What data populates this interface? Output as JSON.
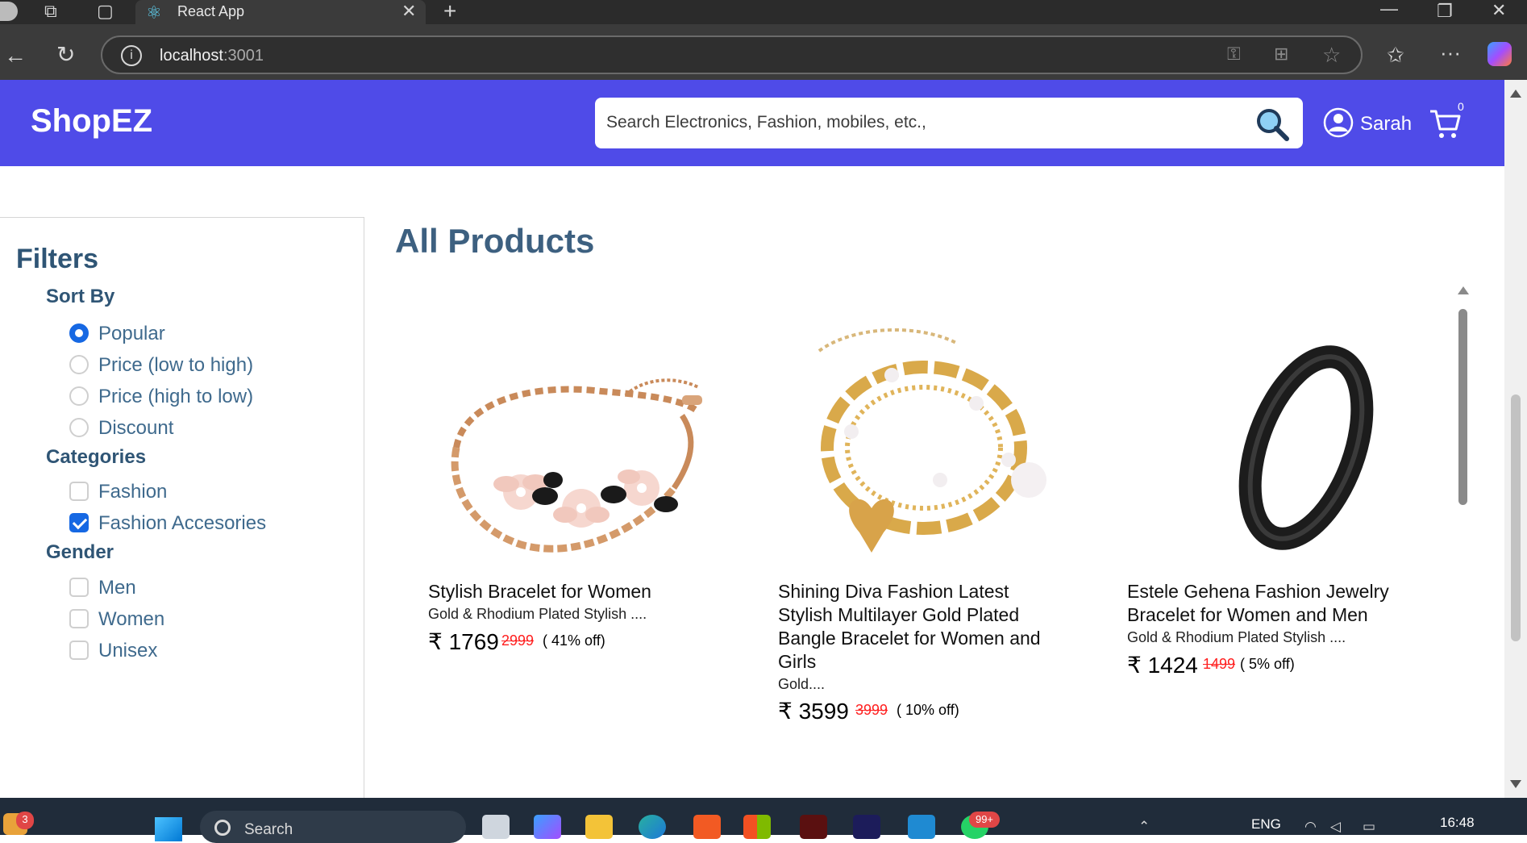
{
  "browser": {
    "tab_title": "React App",
    "url_host": "localhost",
    "url_port": ":3001"
  },
  "header": {
    "logo": "ShopEZ",
    "search_placeholder": "Search Electronics, Fashion, mobiles, etc.,",
    "user_name": "Sarah",
    "cart_count": "0"
  },
  "filters": {
    "title": "Filters",
    "sort_heading": "Sort By",
    "sort_options": [
      "Popular",
      "Price (low to high)",
      "Price (high to low)",
      "Discount"
    ],
    "sort_selected": "Popular",
    "categories_heading": "Categories",
    "categories": [
      "Fashion",
      "Fashion Accesories"
    ],
    "categories_checked": [
      "Fashion Accesories"
    ],
    "gender_heading": "Gender",
    "genders": [
      "Men",
      "Women",
      "Unisex"
    ]
  },
  "products": {
    "heading": "All Products",
    "items": [
      {
        "title": "Stylish Bracelet for Women",
        "desc": "Gold & Rhodium Plated Stylish ....",
        "price": "₹ 1769",
        "old_price": "2999",
        "discount": "( 41% off)",
        "image": "rose-gold-flower-bracelet"
      },
      {
        "title": "Shining Diva Fashion Latest Stylish Multilayer Gold Plated Bangle Bracelet for Women and Girls",
        "desc": "Gold....",
        "price": "₹ 3599",
        "old_price": "3999",
        "discount": "( 10% off)",
        "image": "gold-chain-pearl-bracelet"
      },
      {
        "title": "Estele Gehena Fashion Jewelry Bracelet for Women and Men",
        "desc": "Gold & Rhodium Plated Stylish ....",
        "price": "₹ 1424",
        "old_price": "1499",
        "discount": "( 5% off)",
        "image": "black-bangle"
      }
    ]
  },
  "taskbar": {
    "search": "Search",
    "language": "ENG",
    "time": "16:48",
    "notification_badge": "3",
    "app_badge": "99+"
  },
  "colors": {
    "brand": "#4f4be8",
    "heading": "#3d6080",
    "accent": "#1668e3",
    "strike_price": "#ff2020"
  }
}
